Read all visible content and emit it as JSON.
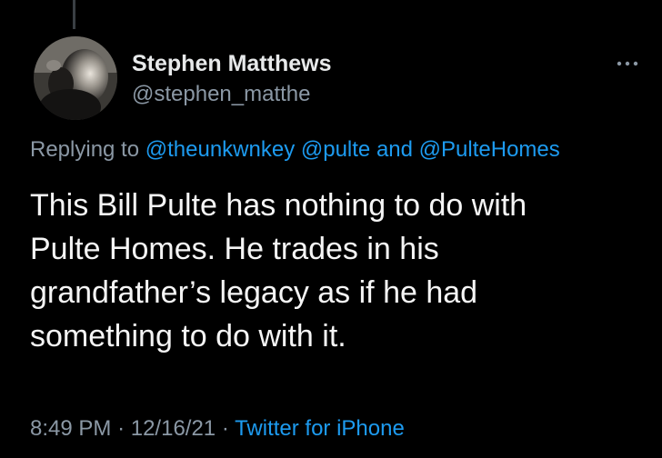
{
  "tweet": {
    "author": {
      "name": "Stephen Matthews",
      "handle": "@stephen_matthe"
    },
    "reply": {
      "prefix": "Replying to",
      "mention_1": "@theunkwnkey",
      "mention_2": "@pulte",
      "conjunction": "and",
      "mention_3": "@PulteHomes"
    },
    "text_lines": [
      "This Bill Pulte has nothing to do with",
      "Pulte Homes. He trades in his",
      "grandfather’s legacy as if he had",
      "something to do with it."
    ],
    "time": "8:49 PM",
    "separator": "·",
    "date": "12/16/21",
    "source": "Twitter for iPhone"
  },
  "icons": {
    "more": "more-horizontal-icon"
  },
  "colors": {
    "background": "#000000",
    "primary_text": "#e7e9ea",
    "secondary_text": "#8b98a5",
    "link": "#1d9bf0"
  }
}
